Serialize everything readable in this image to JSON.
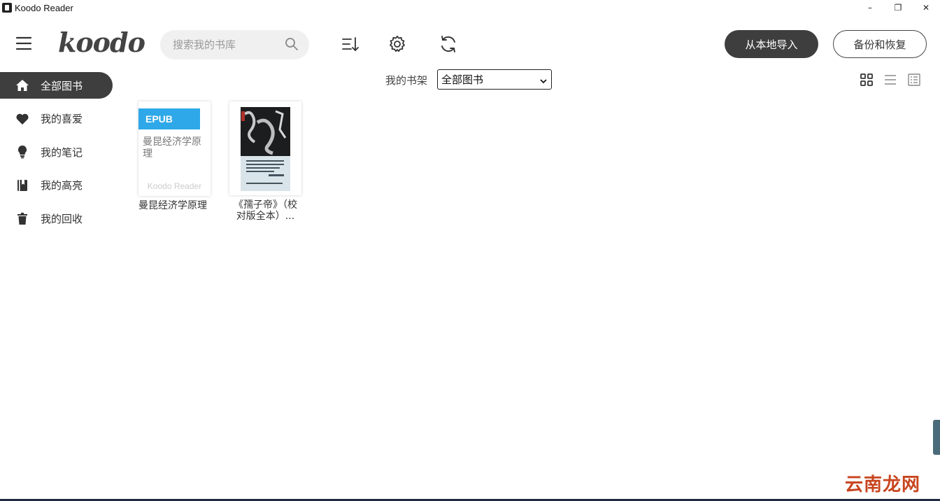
{
  "window": {
    "title": "Koodo Reader",
    "controls": [
      "–",
      "❐",
      "✕"
    ]
  },
  "header": {
    "logo": "koodo",
    "search_placeholder": "搜索我的书库",
    "import_label": "从本地导入",
    "backup_label": "备份和恢复"
  },
  "sidebar": {
    "items": [
      {
        "label": "全部图书",
        "icon": "home-icon",
        "active": true
      },
      {
        "label": "我的喜爱",
        "icon": "heart-icon",
        "active": false
      },
      {
        "label": "我的笔记",
        "icon": "lightbulb-icon",
        "active": false
      },
      {
        "label": "我的高亮",
        "icon": "highlight-book-icon",
        "active": false
      },
      {
        "label": "我的回收",
        "icon": "trash-icon",
        "active": false
      }
    ]
  },
  "shelf": {
    "label": "我的书架",
    "selected": "全部图书"
  },
  "books": [
    {
      "format": "EPUB",
      "cover_title": "曼昆经济学原理",
      "cover_brand": "Koodo Reader",
      "title": "曼昆经济学原理"
    },
    {
      "title_line1": "《孺子帝》（校",
      "title_line2": "对版全本）..."
    }
  ],
  "watermark": "云南龙网",
  "colors": {
    "accent_dark": "#3e3e3e",
    "epub_blue": "#2ea8e8",
    "watermark_red": "#c8451f"
  }
}
